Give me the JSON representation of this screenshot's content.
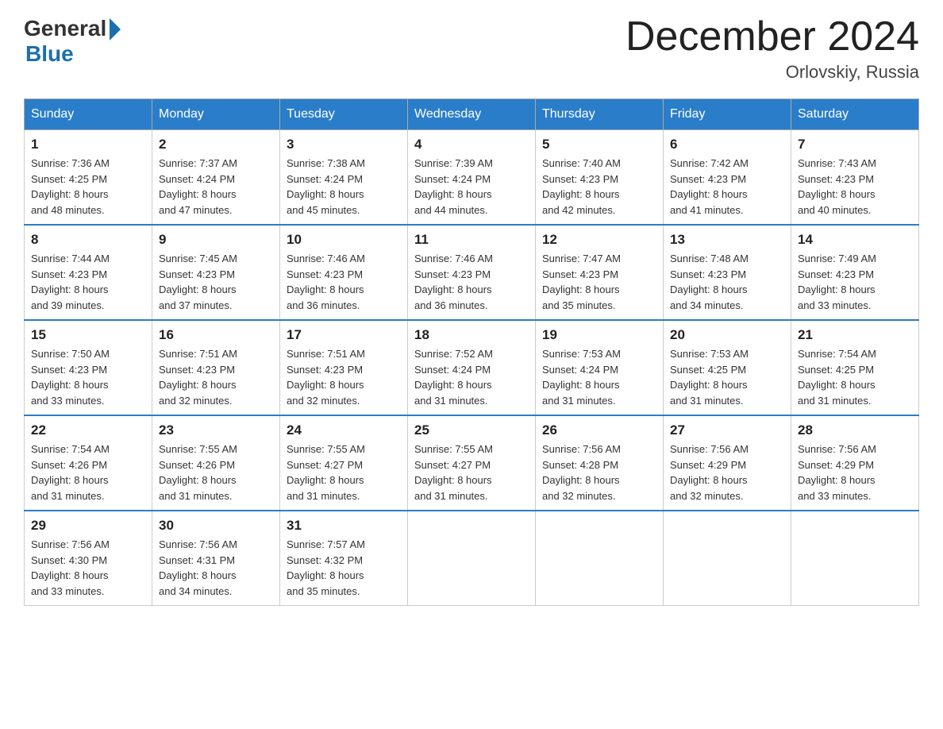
{
  "header": {
    "logo_general": "General",
    "logo_blue": "Blue",
    "month_title": "December 2024",
    "location": "Orlovskiy, Russia"
  },
  "weekdays": [
    "Sunday",
    "Monday",
    "Tuesday",
    "Wednesday",
    "Thursday",
    "Friday",
    "Saturday"
  ],
  "weeks": [
    [
      {
        "day": "1",
        "sunrise": "7:36 AM",
        "sunset": "4:25 PM",
        "daylight": "8 hours and 48 minutes."
      },
      {
        "day": "2",
        "sunrise": "7:37 AM",
        "sunset": "4:24 PM",
        "daylight": "8 hours and 47 minutes."
      },
      {
        "day": "3",
        "sunrise": "7:38 AM",
        "sunset": "4:24 PM",
        "daylight": "8 hours and 45 minutes."
      },
      {
        "day": "4",
        "sunrise": "7:39 AM",
        "sunset": "4:24 PM",
        "daylight": "8 hours and 44 minutes."
      },
      {
        "day": "5",
        "sunrise": "7:40 AM",
        "sunset": "4:23 PM",
        "daylight": "8 hours and 42 minutes."
      },
      {
        "day": "6",
        "sunrise": "7:42 AM",
        "sunset": "4:23 PM",
        "daylight": "8 hours and 41 minutes."
      },
      {
        "day": "7",
        "sunrise": "7:43 AM",
        "sunset": "4:23 PM",
        "daylight": "8 hours and 40 minutes."
      }
    ],
    [
      {
        "day": "8",
        "sunrise": "7:44 AM",
        "sunset": "4:23 PM",
        "daylight": "8 hours and 39 minutes."
      },
      {
        "day": "9",
        "sunrise": "7:45 AM",
        "sunset": "4:23 PM",
        "daylight": "8 hours and 37 minutes."
      },
      {
        "day": "10",
        "sunrise": "7:46 AM",
        "sunset": "4:23 PM",
        "daylight": "8 hours and 36 minutes."
      },
      {
        "day": "11",
        "sunrise": "7:46 AM",
        "sunset": "4:23 PM",
        "daylight": "8 hours and 36 minutes."
      },
      {
        "day": "12",
        "sunrise": "7:47 AM",
        "sunset": "4:23 PM",
        "daylight": "8 hours and 35 minutes."
      },
      {
        "day": "13",
        "sunrise": "7:48 AM",
        "sunset": "4:23 PM",
        "daylight": "8 hours and 34 minutes."
      },
      {
        "day": "14",
        "sunrise": "7:49 AM",
        "sunset": "4:23 PM",
        "daylight": "8 hours and 33 minutes."
      }
    ],
    [
      {
        "day": "15",
        "sunrise": "7:50 AM",
        "sunset": "4:23 PM",
        "daylight": "8 hours and 33 minutes."
      },
      {
        "day": "16",
        "sunrise": "7:51 AM",
        "sunset": "4:23 PM",
        "daylight": "8 hours and 32 minutes."
      },
      {
        "day": "17",
        "sunrise": "7:51 AM",
        "sunset": "4:23 PM",
        "daylight": "8 hours and 32 minutes."
      },
      {
        "day": "18",
        "sunrise": "7:52 AM",
        "sunset": "4:24 PM",
        "daylight": "8 hours and 31 minutes."
      },
      {
        "day": "19",
        "sunrise": "7:53 AM",
        "sunset": "4:24 PM",
        "daylight": "8 hours and 31 minutes."
      },
      {
        "day": "20",
        "sunrise": "7:53 AM",
        "sunset": "4:25 PM",
        "daylight": "8 hours and 31 minutes."
      },
      {
        "day": "21",
        "sunrise": "7:54 AM",
        "sunset": "4:25 PM",
        "daylight": "8 hours and 31 minutes."
      }
    ],
    [
      {
        "day": "22",
        "sunrise": "7:54 AM",
        "sunset": "4:26 PM",
        "daylight": "8 hours and 31 minutes."
      },
      {
        "day": "23",
        "sunrise": "7:55 AM",
        "sunset": "4:26 PM",
        "daylight": "8 hours and 31 minutes."
      },
      {
        "day": "24",
        "sunrise": "7:55 AM",
        "sunset": "4:27 PM",
        "daylight": "8 hours and 31 minutes."
      },
      {
        "day": "25",
        "sunrise": "7:55 AM",
        "sunset": "4:27 PM",
        "daylight": "8 hours and 31 minutes."
      },
      {
        "day": "26",
        "sunrise": "7:56 AM",
        "sunset": "4:28 PM",
        "daylight": "8 hours and 32 minutes."
      },
      {
        "day": "27",
        "sunrise": "7:56 AM",
        "sunset": "4:29 PM",
        "daylight": "8 hours and 32 minutes."
      },
      {
        "day": "28",
        "sunrise": "7:56 AM",
        "sunset": "4:29 PM",
        "daylight": "8 hours and 33 minutes."
      }
    ],
    [
      {
        "day": "29",
        "sunrise": "7:56 AM",
        "sunset": "4:30 PM",
        "daylight": "8 hours and 33 minutes."
      },
      {
        "day": "30",
        "sunrise": "7:56 AM",
        "sunset": "4:31 PM",
        "daylight": "8 hours and 34 minutes."
      },
      {
        "day": "31",
        "sunrise": "7:57 AM",
        "sunset": "4:32 PM",
        "daylight": "8 hours and 35 minutes."
      },
      null,
      null,
      null,
      null
    ]
  ],
  "labels": {
    "sunrise": "Sunrise:",
    "sunset": "Sunset:",
    "daylight": "Daylight:"
  }
}
